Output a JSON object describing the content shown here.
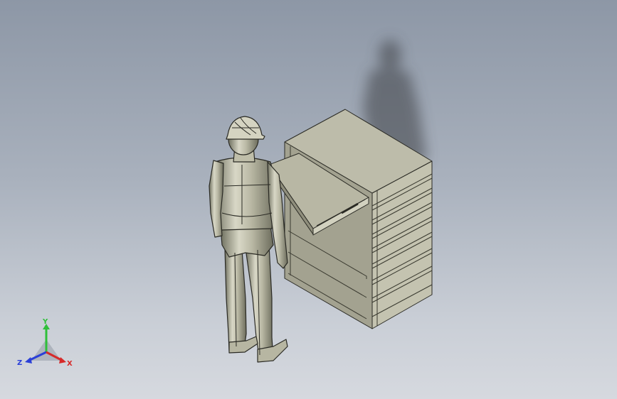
{
  "view": {
    "background_top": "#8d97a6",
    "background_bottom": "#d6d9df"
  },
  "model": {
    "parts": [
      "figure",
      "cabinet",
      "drawer",
      "shadow"
    ],
    "body_color": "#c9c8b5",
    "dark_side_color": "#8f8e7c",
    "outline_color": "#2a2a24"
  },
  "triad": {
    "y_label": "Y",
    "z_label": "Z",
    "x_label": "X",
    "y_color": "#2fbf3a",
    "z_color": "#2a3fd8",
    "x_color": "#d62a2a"
  }
}
